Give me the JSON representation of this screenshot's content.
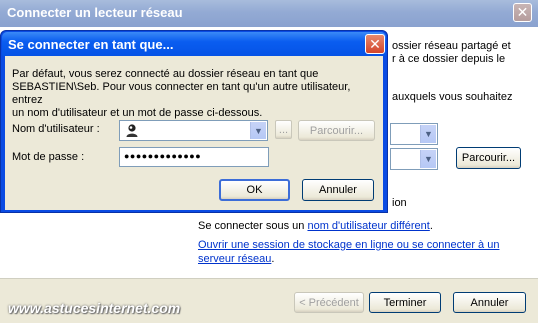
{
  "background_window": {
    "title": "Connecter un lecteur réseau",
    "close_glyph": "✕",
    "partial_text_1a": "ossier réseau partagé et",
    "partial_text_1b": "r à ce dossier depuis le",
    "partial_text_2": "auxquels vous souhaitez",
    "partial_text_3": "ion",
    "browse_button": "Parcourir...",
    "connect_as_prefix": "Se connecter sous un ",
    "connect_as_link": "nom d'utilisateur différent",
    "connect_as_suffix": ".",
    "storage_link_line1": "Ouvrir une session de stockage en ligne ou se connecter à un",
    "storage_link_line2": "serveur réseau",
    "storage_link_suffix": ".",
    "footer": {
      "previous": "< Précédent",
      "finish": "Terminer",
      "cancel": "Annuler"
    }
  },
  "dialog": {
    "title": "Se connecter en tant que...",
    "close_glyph": "✕",
    "description_line1": "Par défaut, vous serez connecté au dossier réseau en tant que",
    "description_line2": "SEBASTIEN\\Seb. Pour vous connecter en tant qu'un autre utilisateur, entrez",
    "description_line3": "un nom d'utilisateur et un mot de passe ci-dessous.",
    "username_label": "Nom d'utilisateur :",
    "username_value": "",
    "password_label": "Mot de passe :",
    "password_value": "●●●●●●●●●●●●●",
    "ellipsis_button": "...",
    "browse_button": "Parcourir...",
    "ok_button": "OK",
    "cancel_button": "Annuler"
  },
  "watermark": "www.astucesinternet.com"
}
